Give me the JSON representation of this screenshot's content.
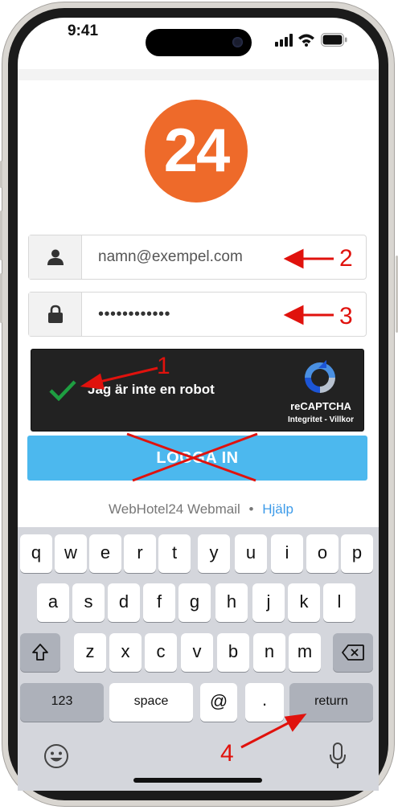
{
  "status_bar": {
    "time": "9:41"
  },
  "login": {
    "logo_text": "24",
    "email_value": "namn@exempel.com",
    "password_value": "••••••••••••",
    "recaptcha": {
      "label": "Jag är inte en robot",
      "brand": "reCAPTCHA",
      "links": "Integritet - Villkor"
    },
    "login_button": "LOGGA IN",
    "footer_text": "WebHotel24 Webmail",
    "footer_sep": "•",
    "help_link": "Hjälp"
  },
  "keyboard": {
    "row1": [
      "q",
      "w",
      "e",
      "r",
      "t",
      "y",
      "u",
      "i",
      "o",
      "p"
    ],
    "row2": [
      "a",
      "s",
      "d",
      "f",
      "g",
      "h",
      "j",
      "k",
      "l"
    ],
    "row3": [
      "z",
      "x",
      "c",
      "v",
      "b",
      "n",
      "m"
    ],
    "numbers_key": "123",
    "space_key": "space",
    "at_key": "@",
    "dot_key": ".",
    "return_key": "return"
  },
  "annotations": [
    "1",
    "2",
    "3",
    "4"
  ],
  "colors": {
    "logo": "#ee6a2a",
    "login_button": "#4cb8ee",
    "annotation": "#e0120d",
    "help_link": "#3d9be9"
  }
}
